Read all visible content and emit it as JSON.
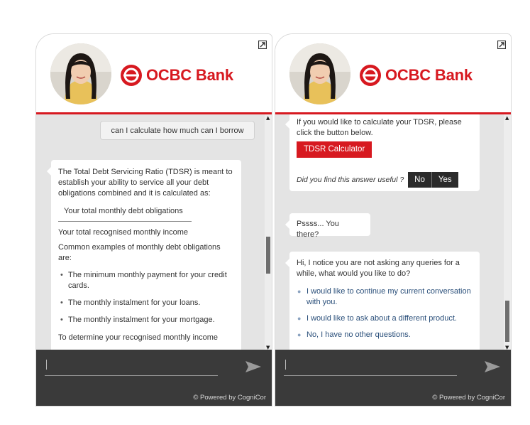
{
  "brand": {
    "name": "OCBC Bank",
    "color": "#d71920",
    "footer_text": "© Powered by CogniCor"
  },
  "left_panel": {
    "user_message": "can I calculate how much can I borrow",
    "bot_intro": "The Total Debt Servicing Ratio (TDSR) is meant to establish your ability to service all your debt obligations combined and it is calculated as:",
    "fraction_numerator": "Your total monthly debt obligations",
    "fraction_denominator": "Your total recognised monthly income",
    "examples_heading": "Common examples of monthly debt obligations are:",
    "examples": [
      "The minimum monthly payment for your credit cards.",
      "The monthly instalment for your loans.",
      "The monthly instalment for your mortgage."
    ],
    "cutoff_text": "To determine your recognised monthly income"
  },
  "right_panel": {
    "tdsr_prompt": "If you would like to calculate your TDSR, please click the button below.",
    "tdsr_button": "TDSR Calculator",
    "feedback_question": "Did you find this answer useful ?",
    "feedback_no": "No",
    "feedback_yes": "Yes",
    "idle_message": "Pssss... You there?",
    "idle_prompt": "Hi, I notice you are not asking any queries for a while, what would you like to do?",
    "options": [
      "I would like to continue my current conversation with you.",
      "I would like to ask about a different product.",
      "No, I have no other questions."
    ]
  },
  "icons": {
    "expand": "expand-icon",
    "send": "send-icon",
    "logo": "ocbc-logo-icon",
    "bullet": "•",
    "option_bullet": "●"
  }
}
